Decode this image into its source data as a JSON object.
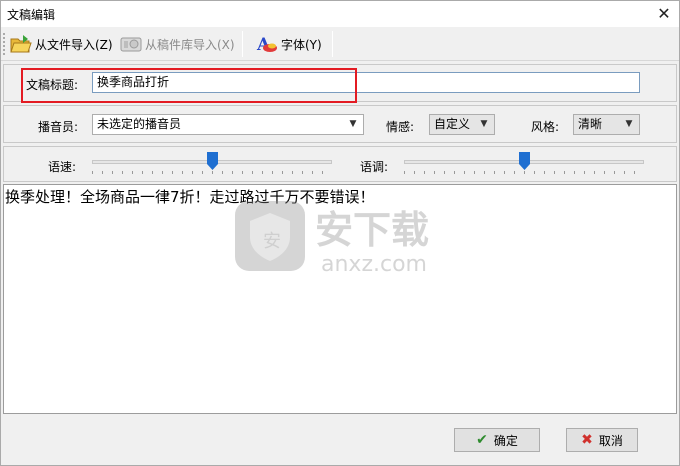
{
  "window": {
    "title": "文稿编辑",
    "close_glyph": "✕"
  },
  "toolbar": {
    "import_file_label": "从文件导入(Z)",
    "import_library_label": "从稿件库导入(X)",
    "font_label": "字体(Y)"
  },
  "title_row": {
    "label": "文稿标题:",
    "value": "换季商品打折"
  },
  "voice_row": {
    "announcer_label": "播音员:",
    "announcer_value": "未选定的播音员",
    "emotion_label": "情感:",
    "emotion_value": "自定义",
    "style_label": "风格:",
    "style_value": "清晰"
  },
  "sliders": {
    "speed_label": "语速:",
    "speed_level": 0.5,
    "pitch_label": "语调:",
    "pitch_level": 0.5
  },
  "editor": {
    "text": "换季处理！全场商品一律7折！走过路过千万不要错误！"
  },
  "watermark": {
    "text_cn": "安下载",
    "text_en": "anxz.com"
  },
  "buttons": {
    "ok_label": "确定",
    "cancel_label": "取消"
  },
  "colors": {
    "highlight": "#e31b23",
    "slider_thumb": "#1f6fd1",
    "ok_icon": "#2e8b2e",
    "cancel_icon": "#d0312d"
  }
}
